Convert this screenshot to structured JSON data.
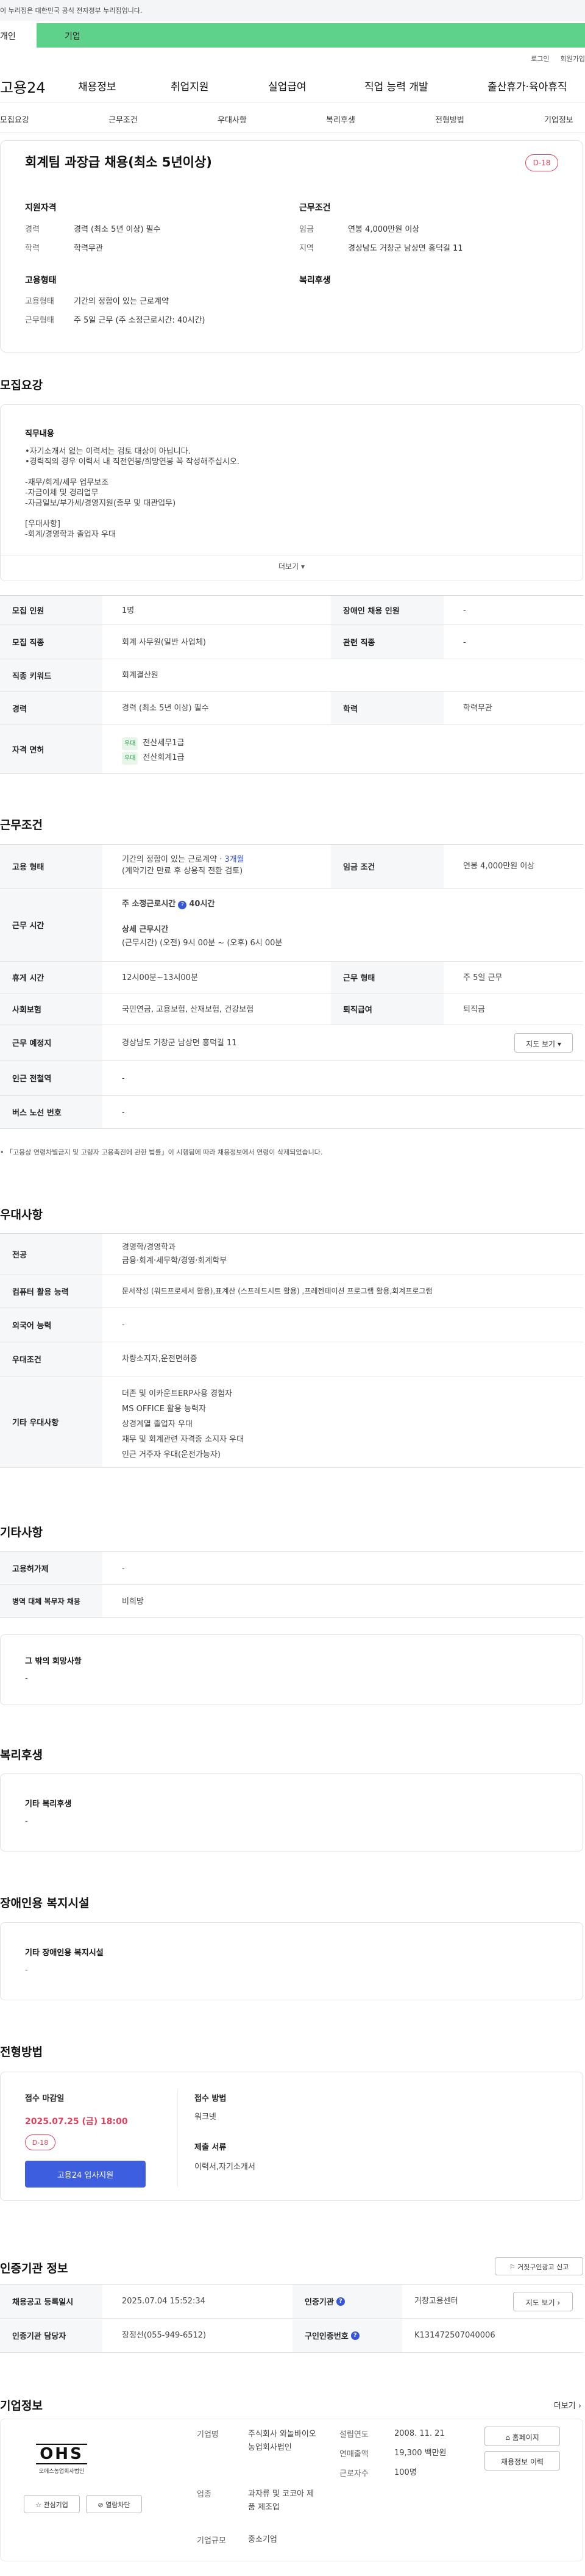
{
  "gov_banner": "이 누리집은 대한민국 공식 전자정부 누리집입니다.",
  "top_tabs": {
    "personal": "개인",
    "company": "기업"
  },
  "util": {
    "login": "로그인",
    "join": "회원가입"
  },
  "gnb": {
    "logo": "고용24",
    "menu": [
      "채용정보",
      "취업지원",
      "실업급여",
      "직업 능력 개발",
      "출산휴가·육아휴직"
    ]
  },
  "snb": [
    "모집요강",
    "근무조건",
    "우대사항",
    "복리후생",
    "전형방법",
    "기업정보"
  ],
  "job": {
    "title": "회계팀 과장급 채용(최소 5년이상)",
    "dday": "D-18",
    "qual_title": "지원자격",
    "qual": [
      {
        "k": "경력",
        "v": "경력 (최소 5년 이상) 필수"
      },
      {
        "k": "학력",
        "v": "학력무관"
      }
    ],
    "emp_title": "고용형태",
    "emp": [
      {
        "k": "고용형태",
        "v": "기간의 정함이 있는 근로계약"
      },
      {
        "k": "근무형태",
        "v": "주 5일 근무 (주 소정근로시간: 40시간)"
      }
    ],
    "cond_title": "근무조건",
    "cond": [
      {
        "k": "임금",
        "v": "연봉 4,000만원 이상"
      },
      {
        "k": "지역",
        "v": "경상남도 거창군 남상면 홍덕길 11"
      }
    ],
    "welfare_title": "복리후생"
  },
  "recruit": {
    "title": "모집요강",
    "duty_title": "직무내용",
    "duty_text": "•자기소개서 없는 이력서는 검토 대상이 아닙니다.\n•경력직의 경우 이력서 내 직전연봉/희망연봉 꼭 작성해주십시오.\n\n-재무/회계/세무 업무보조\n-자금이체 및 경리업무\n-자금일보/부가세/경영지원(총무 및 대관업무)\n\n[우대사항]\n-회계/경영학과 졸업자 우대",
    "more": "더보기",
    "rows": [
      {
        "k": "모집 인원",
        "v": "1명",
        "k2": "장애인 채용 인원",
        "v2": "-"
      },
      {
        "k": "모집 직종",
        "v": "회계 사무원(일반 사업체)",
        "k2": "관련 직종",
        "v2": "-"
      },
      {
        "k": "직종 키워드",
        "v": "회계결산원"
      },
      {
        "k": "경력",
        "v": "경력 (최소 5년 이상) 필수",
        "k2": "학력",
        "v2": "학력무관"
      }
    ],
    "license_label": "자격 면허",
    "licenses": [
      {
        "badge": "우대",
        "name": "전산세무1급"
      },
      {
        "badge": "우대",
        "name": "전산회계1급"
      }
    ]
  },
  "work": {
    "title": "근무조건",
    "emp_label": "고용 형태",
    "emp_v1": "기간의 정함이 있는 근로계약 · ",
    "emp_months": "3개월",
    "emp_v2": "(계약기간 만료 후 상용직 전환 검토)",
    "wage_label": "임금 조건",
    "wage": "연봉 4,000만원 이상",
    "hours_label": "근무 시간",
    "week_hours": "주 소정근로시간",
    "week_hours_val": "40시간",
    "detail_title": "상세 근무시간",
    "detail": "(근무시간) (오전) 9시 00분 ~ (오후) 6시 00분",
    "rest_label": "휴게 시간",
    "rest": "12시00분~13시00분",
    "form_label": "근무 형태",
    "form": "주 5일 근무",
    "ins_label": "사회보험",
    "ins": "국민연금, 고용보험, 산재보험, 건강보험",
    "sev_label": "퇴직급여",
    "sev": "퇴직금",
    "place_label": "근무 예정지",
    "place": "경상남도 거창군 남상면 홍덕길 11",
    "map_btn": "지도 보기",
    "station_label": "인근 전철역",
    "station": "-",
    "bus_label": "버스 노선 번호",
    "bus": "-",
    "notice": "「고용상 연령차별금지 및 고령자 고용촉진에 관한 법률」이 시행됨에 따라 채용정보에서 연령이 삭제되었습니다."
  },
  "pref": {
    "title": "우대사항",
    "rows": [
      {
        "k": "전공",
        "v": "경영학/경영학과\n금융·회계·세무학/경영·회계학부"
      },
      {
        "k": "컴퓨터 활용 능력",
        "v": "문서작성 (워드프로세서 활용),표계산 (스프레드시트 활용) ,프레젠테이션 프로그램 활용,회계프로그램"
      },
      {
        "k": "외국어 능력",
        "v": "-"
      },
      {
        "k": "우대조건",
        "v": "차량소지자,운전면허증"
      },
      {
        "k": "기타 우대사항",
        "v": "더존 및 이카운트ERP사용 경험자\nMS OFFICE 활용 능력자\n상경계열 졸업자 우대\n재무 및 회계관련 자격증 소지자 우대\n인근 거주자 우대(운전가능자)"
      }
    ]
  },
  "etc": {
    "title": "기타사항",
    "rows": [
      {
        "k": "고용허가제",
        "v": "-"
      },
      {
        "k": "병역 대체 복무자 채용",
        "v": "비희망"
      }
    ],
    "wish_title": "그 밖의 희망사항",
    "wish": "-"
  },
  "welfare": {
    "title": "복리후생",
    "sub": "기타 복리후생",
    "val": "-"
  },
  "disab": {
    "title": "장애인용 복지시설",
    "sub": "기타 장애인용 복지시설",
    "val": "-"
  },
  "screen": {
    "title": "전형방법",
    "deadline_label": "접수 마감일",
    "deadline": "2025.07.25 (금) 18:00",
    "dday": "D-18",
    "apply_btn": "고용24 입사지원",
    "method_label": "접수 방법",
    "method": "워크넷",
    "docs_label": "제출 서류",
    "docs": "이력서,자기소개서"
  },
  "agency": {
    "title": "인증기관 정보",
    "report_btn": "거짓구인광고 신고",
    "rows": [
      {
        "k": "채용공고 등록일시",
        "v": "2025.07.04 15:52:34",
        "k2": "인증기관",
        "v2": "거창고용센터",
        "btn": "지도 보기"
      },
      {
        "k": "인증기관 담당자",
        "v": "장정선(055-949-6512)",
        "k2": "구인인증번호",
        "v2": "K131472507040006"
      }
    ]
  },
  "company": {
    "title": "기업정보",
    "more": "더보기",
    "logo_text": "OHS",
    "logo_sub": "오에스농업회사법인",
    "fav_btn": "관심기업",
    "block_btn": "열람차단",
    "name_label": "기업명",
    "name": "주식회사 와놀바이오 농업회사법인",
    "ind_label": "업종",
    "ind": "과자류 및 코코아 제품 제조업",
    "size_label": "기업규모",
    "size": "중소기업",
    "est_label": "설립연도",
    "est": "2008. 11. 21",
    "sales_label": "연매출액",
    "sales": "19,300 백만원",
    "emp_label": "근로자수",
    "emp": "100명",
    "home_btn": "홈페이지",
    "jobs_btn": "채용정보 이력"
  },
  "colors": {
    "accent": "#3656d6",
    "green": "#5ed18a",
    "dday": "#e0405b"
  }
}
